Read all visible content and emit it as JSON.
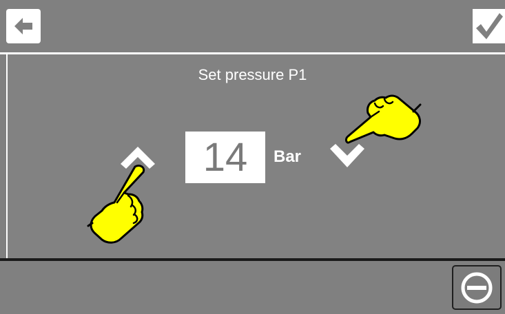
{
  "screen": {
    "title": "Set pressure P1",
    "value": "14",
    "unit": "Bar"
  },
  "icons": {
    "back": "arrow-left-icon",
    "confirm": "check-icon",
    "increase": "chevron-up-icon",
    "decrease": "chevron-down-icon",
    "pointer": "pointing-hand-icon",
    "stop": "minus-circle-icon"
  },
  "colors": {
    "background": "#808080",
    "value_box": "#ffffff",
    "hand": "#ffff00"
  }
}
